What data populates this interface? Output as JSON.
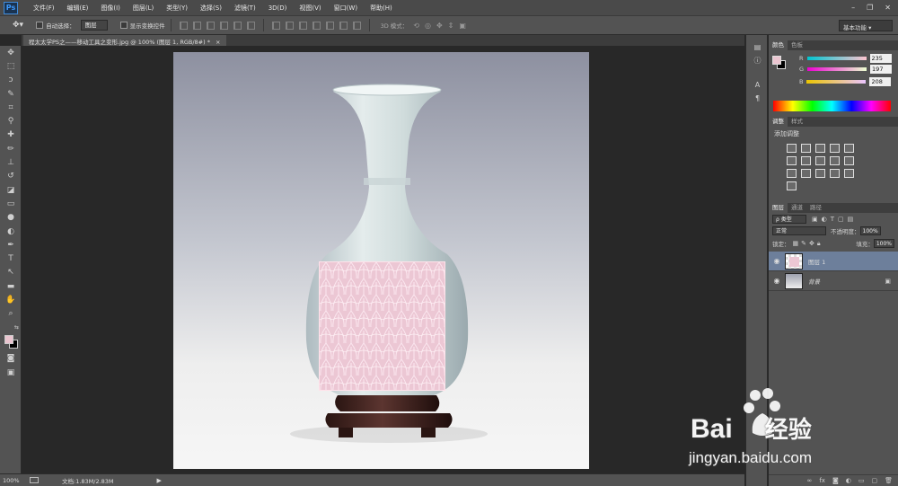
{
  "app": {
    "logo": "Ps"
  },
  "menubar": {
    "items": [
      "文件(F)",
      "编辑(E)",
      "图像(I)",
      "图层(L)",
      "类型(Y)",
      "选择(S)",
      "滤镜(T)",
      "3D(D)",
      "视图(V)",
      "窗口(W)",
      "帮助(H)"
    ],
    "window_buttons": [
      "–",
      "❐",
      "✕"
    ]
  },
  "options": {
    "auto_select_label": "自动选择：",
    "auto_select_value": "图层",
    "show_transform_label": "显示变换控件",
    "mode_3d_label": "3D 模式：",
    "workspace": "基本功能"
  },
  "document": {
    "tab_title": "程太太学PS之——移动工具之变形.jpg @ 100% (图层 1, RGB/8#) *",
    "close": "×"
  },
  "status": {
    "zoom": "100%",
    "doc_info": "文档:1.83M/2.83M"
  },
  "color_panel": {
    "tabs": [
      "颜色",
      "色板"
    ],
    "channels": [
      {
        "label": "R",
        "value": "235"
      },
      {
        "label": "G",
        "value": "197"
      },
      {
        "label": "B",
        "value": "208"
      }
    ],
    "foreground": "#ebc5d0",
    "background": "#000000"
  },
  "adjust_panel": {
    "tabs": [
      "调整",
      "样式"
    ],
    "title": "添加调整"
  },
  "layers_panel": {
    "tabs": [
      "图层",
      "通道",
      "路径"
    ],
    "filter": "ρ 类型",
    "blend_mode": "正常",
    "opacity_label": "不透明度：",
    "opacity_value": "100%",
    "lock_label": "锁定：",
    "fill_label": "填充：",
    "fill_value": "100%",
    "layers": [
      {
        "name": "图层 1",
        "selected": true
      },
      {
        "name": "背景",
        "selected": false,
        "locked": true
      }
    ],
    "footer_icons": [
      "link-icon",
      "fx-icon",
      "mask-icon",
      "adjustment-icon",
      "folder-icon",
      "new-layer-icon",
      "trash-icon"
    ]
  },
  "watermark": {
    "brand": "Bai",
    "brand_suffix": "经验",
    "url": "jingyan.baidu.com"
  }
}
